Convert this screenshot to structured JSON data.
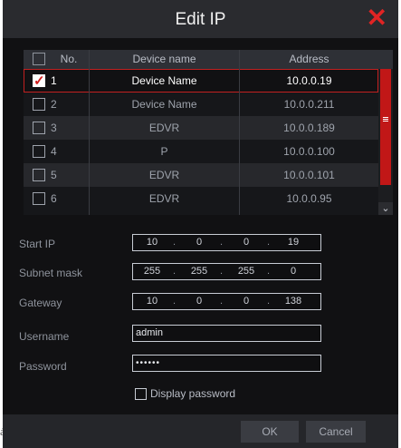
{
  "dialog": {
    "title": "Edit IP",
    "close_icon": "close-icon (red ×)",
    "close_glyph": "✕"
  },
  "table": {
    "headers": {
      "no": "No.",
      "device_name": "Device name",
      "address": "Address"
    },
    "rows": [
      {
        "no": "1",
        "name": "Device Name",
        "address": "10.0.0.19",
        "checked": true
      },
      {
        "no": "2",
        "name": "Device Name",
        "address": "10.0.0.211",
        "checked": false
      },
      {
        "no": "3",
        "name": "EDVR",
        "address": "10.0.0.189",
        "checked": false
      },
      {
        "no": "4",
        "name": "P",
        "address": "10.0.0.100",
        "checked": false
      },
      {
        "no": "5",
        "name": "EDVR",
        "address": "10.0.0.101",
        "checked": false
      },
      {
        "no": "6",
        "name": "EDVR",
        "address": "10.0.0.95",
        "checked": false
      }
    ],
    "scroll_down_glyph": "⌄"
  },
  "form": {
    "start_ip": {
      "label": "Start IP",
      "octets": [
        "10",
        "0",
        "0",
        "19"
      ]
    },
    "subnet_mask": {
      "label": "Subnet mask",
      "octets": [
        "255",
        "255",
        "255",
        "0"
      ]
    },
    "gateway": {
      "label": "Gateway",
      "octets": [
        "10",
        "0",
        "0",
        "138"
      ]
    },
    "username": {
      "label": "Username",
      "value": "admin"
    },
    "password": {
      "label": "Password",
      "value": "••••••"
    },
    "display_password": {
      "label": "Display password",
      "checked": false
    },
    "dot_sep": "."
  },
  "footer": {
    "ok_label": "OK",
    "cancel_label": "Cancel"
  },
  "stray_text": "ás",
  "colors": {
    "accent_red": "#e02424",
    "selection_outline": "#c12020",
    "dialog_bg": "#111113"
  }
}
